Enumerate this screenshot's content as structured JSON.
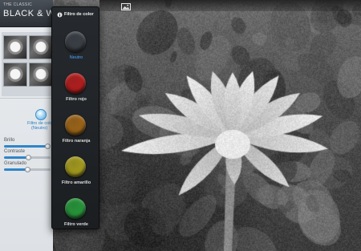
{
  "app": {
    "subtitle": "THE CLASSIC",
    "title": "BLACK & WHITE"
  },
  "thumbnails": [
    {
      "name": "thumbnail-1"
    },
    {
      "name": "thumbnail-2"
    },
    {
      "name": "thumbnail-3"
    },
    {
      "name": "thumbnail-4"
    }
  ],
  "color_filter": {
    "label": "Filtro de color",
    "value": "(Neutro)"
  },
  "adjustments": [
    {
      "key": "brillo",
      "label": "Brillo",
      "level": 0.94
    },
    {
      "key": "contraste",
      "label": "Contraste",
      "level": 0.52
    },
    {
      "key": "granulado",
      "label": "Granulado",
      "level": 0.5
    }
  ],
  "popover": {
    "title": "Filtro de color",
    "options": [
      {
        "label": "Neutro",
        "color": "#3a3f45",
        "selected": true
      },
      {
        "label": "Filtro rojo",
        "color": "#b21e1e",
        "selected": false
      },
      {
        "label": "Filtro naranja",
        "color": "#9b6418",
        "selected": false
      },
      {
        "label": "Filtro amarillo",
        "color": "#a39a1e",
        "selected": false
      },
      {
        "label": "Filtro verde",
        "color": "#27953a",
        "selected": false
      }
    ]
  },
  "icons": {
    "popover_title": "circle-info-icon",
    "toolbar": "image-icon"
  },
  "colors": {
    "accent": "#2f85c9",
    "selected_text": "#4ba3ff"
  }
}
